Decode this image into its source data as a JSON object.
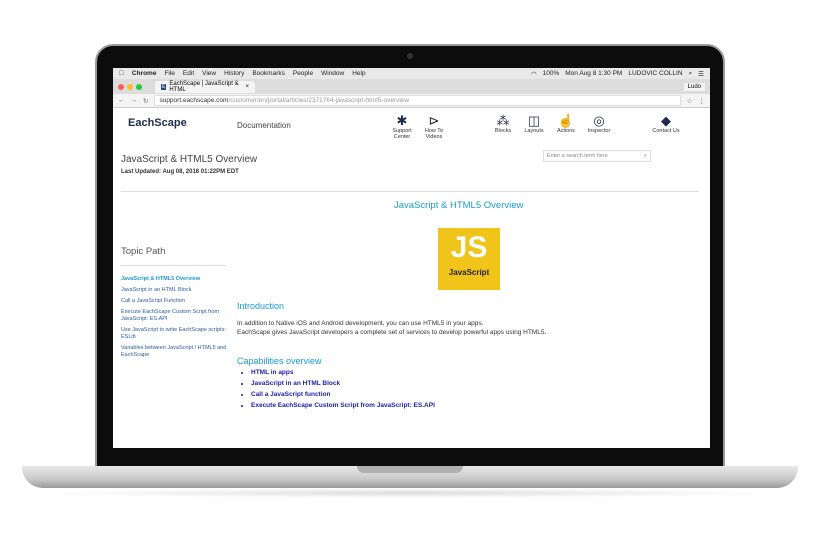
{
  "menubar": {
    "app": "Chrome",
    "items": [
      "File",
      "Edit",
      "View",
      "History",
      "Bookmarks",
      "People",
      "Window",
      "Help"
    ],
    "battery": "100%",
    "datetime": "Mon Aug 8  1:30 PM",
    "user": "LUDOVIC COLLIN"
  },
  "browser": {
    "tab_title": "EachScape | JavaScript & HTML",
    "profile": "Ludo",
    "url_domain": "support.eachscape.com",
    "url_path": "/customer/en/portal/articles/2371764-javascript-html5-overview"
  },
  "site": {
    "logo": "EachScape",
    "section": "Documentation",
    "nav": [
      {
        "label": "Support Center",
        "icon": "puzzle-icon"
      },
      {
        "label": "How To Videos",
        "icon": "play-icon"
      },
      {
        "label": "Blocks",
        "icon": "blocks-icon"
      },
      {
        "label": "Layouts",
        "icon": "layouts-icon"
      },
      {
        "label": "Actions",
        "icon": "hand-icon"
      },
      {
        "label": "Inspector",
        "icon": "inspector-icon"
      },
      {
        "label": "Contact Us",
        "icon": "contact-icon"
      }
    ],
    "page_title": "JavaScript & HTML5 Overview",
    "last_updated": "Last Updated: Aug 08, 2016 01:22PM EDT",
    "search_placeholder": "Enter a search term here"
  },
  "sidebar": {
    "heading": "Topic Path",
    "links": [
      "JavaScript & HTML5 Overview",
      "JavaScript in an HTML Block",
      "Call a JavaScript Function",
      "Execute EachScape Custom Script from JavaScript: ES.API",
      "Use JavaScript to write EachScape scripts: ESLib",
      "Variables between JavaScript / HTML5 and EachScape"
    ]
  },
  "article": {
    "title": "JavaScript & HTML5 Overview",
    "logo_text": "JS",
    "logo_caption": "JavaScript",
    "intro_heading": "Introduction",
    "intro_lines": [
      "In addition to Native iOS and Android development, you can use HTML5 in your apps.",
      "EachScape gives JavaScript developers a complete set of services to develop powerful apps using HTML5."
    ],
    "cap_heading": "Capabilities overview",
    "caps": [
      "HTML in apps",
      "JavaScript in an HTML Block",
      "Call a JavaScript function",
      "Execute EachScape Custom Script from JavaScript: ES.API"
    ]
  },
  "colors": {
    "accent": "#1a9bd7",
    "link": "#1c1ca8",
    "js_yellow": "#f0c419"
  }
}
